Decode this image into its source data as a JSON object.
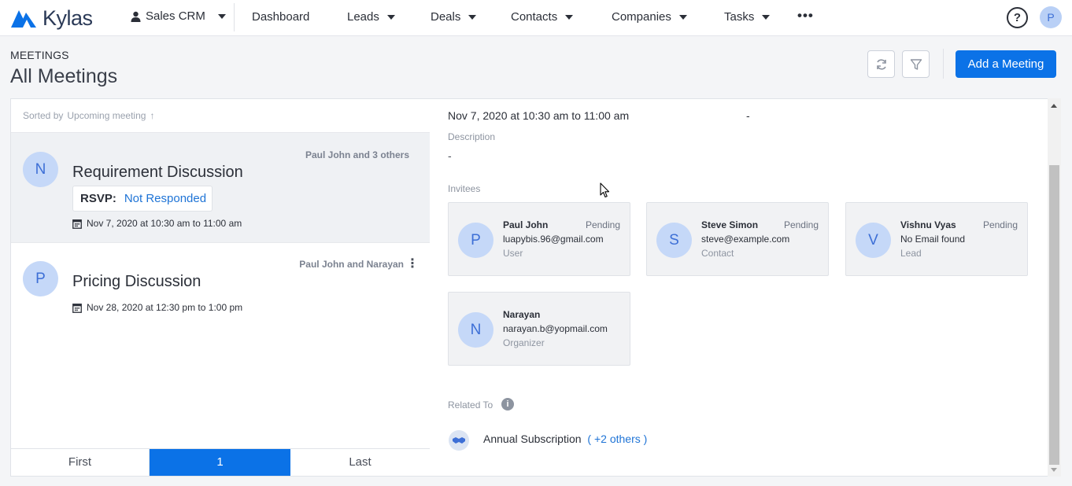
{
  "brand": {
    "name": "Kylas"
  },
  "app_switcher": {
    "label": "Sales CRM"
  },
  "nav": {
    "dashboard": "Dashboard",
    "leads": "Leads",
    "deals": "Deals",
    "contacts": "Contacts",
    "companies": "Companies",
    "tasks": "Tasks",
    "more": "•••"
  },
  "help": {
    "label": "?"
  },
  "user": {
    "initial": "P"
  },
  "page": {
    "eyebrow": "MEETINGS",
    "title": "All Meetings",
    "add_button": "Add a Meeting"
  },
  "list": {
    "sort_prefix": "Sorted by",
    "sort_field": "Upcoming meeting",
    "sort_arrow": "↑",
    "meetings": [
      {
        "initial": "N",
        "title": "Requirement Discussion",
        "participants": "Paul John and 3 others",
        "rsvp_label": "RSVP:",
        "rsvp_value": "Not Responded",
        "date": "Nov 7, 2020 at 10:30 am to 11:00 am"
      },
      {
        "initial": "P",
        "title": "Pricing Discussion",
        "participants": "Paul John and Narayan",
        "date": "Nov 28, 2020 at 12:30 pm to 1:00 pm"
      }
    ]
  },
  "pagination": {
    "first": "First",
    "current": "1",
    "last": "Last"
  },
  "detail": {
    "when": "Nov 7, 2020 at 10:30 am to 11:00 am",
    "when_extra": "-",
    "description_label": "Description",
    "description_value": "-",
    "invitees_label": "Invitees",
    "invitees": [
      {
        "initial": "P",
        "name": "Paul John",
        "status": "Pending",
        "email": "luapybis.96@gmail.com",
        "role": "User"
      },
      {
        "initial": "S",
        "name": "Steve Simon",
        "status": "Pending",
        "email": "steve@example.com",
        "role": "Contact"
      },
      {
        "initial": "V",
        "name": "Vishnu Vyas",
        "status": "Pending",
        "email": "No Email found",
        "role": "Lead"
      },
      {
        "initial": "N",
        "name": "Narayan",
        "status": "",
        "email": "narayan.b@yopmail.com",
        "role": "Organizer"
      }
    ],
    "related_label": "Related To",
    "related_name": "Annual Subscription",
    "related_more": "( +2 others )"
  },
  "colors": {
    "primary": "#0b72e7",
    "link": "#1f74d6",
    "avatar_bg": "#c5d8f8"
  }
}
